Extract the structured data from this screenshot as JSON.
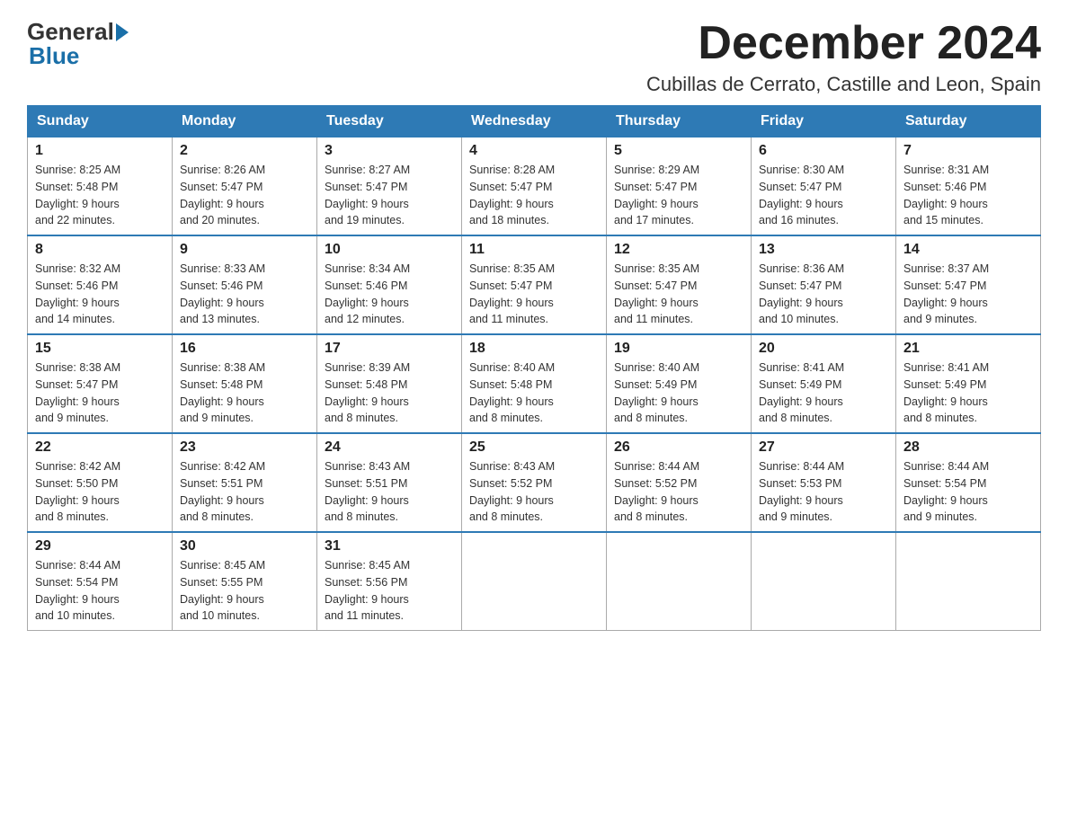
{
  "logo": {
    "general": "General",
    "blue": "Blue"
  },
  "title": {
    "month": "December 2024",
    "location": "Cubillas de Cerrato, Castille and Leon, Spain"
  },
  "weekdays": [
    "Sunday",
    "Monday",
    "Tuesday",
    "Wednesday",
    "Thursday",
    "Friday",
    "Saturday"
  ],
  "weeks": [
    [
      {
        "day": "1",
        "info": "Sunrise: 8:25 AM\nSunset: 5:48 PM\nDaylight: 9 hours\nand 22 minutes."
      },
      {
        "day": "2",
        "info": "Sunrise: 8:26 AM\nSunset: 5:47 PM\nDaylight: 9 hours\nand 20 minutes."
      },
      {
        "day": "3",
        "info": "Sunrise: 8:27 AM\nSunset: 5:47 PM\nDaylight: 9 hours\nand 19 minutes."
      },
      {
        "day": "4",
        "info": "Sunrise: 8:28 AM\nSunset: 5:47 PM\nDaylight: 9 hours\nand 18 minutes."
      },
      {
        "day": "5",
        "info": "Sunrise: 8:29 AM\nSunset: 5:47 PM\nDaylight: 9 hours\nand 17 minutes."
      },
      {
        "day": "6",
        "info": "Sunrise: 8:30 AM\nSunset: 5:47 PM\nDaylight: 9 hours\nand 16 minutes."
      },
      {
        "day": "7",
        "info": "Sunrise: 8:31 AM\nSunset: 5:46 PM\nDaylight: 9 hours\nand 15 minutes."
      }
    ],
    [
      {
        "day": "8",
        "info": "Sunrise: 8:32 AM\nSunset: 5:46 PM\nDaylight: 9 hours\nand 14 minutes."
      },
      {
        "day": "9",
        "info": "Sunrise: 8:33 AM\nSunset: 5:46 PM\nDaylight: 9 hours\nand 13 minutes."
      },
      {
        "day": "10",
        "info": "Sunrise: 8:34 AM\nSunset: 5:46 PM\nDaylight: 9 hours\nand 12 minutes."
      },
      {
        "day": "11",
        "info": "Sunrise: 8:35 AM\nSunset: 5:47 PM\nDaylight: 9 hours\nand 11 minutes."
      },
      {
        "day": "12",
        "info": "Sunrise: 8:35 AM\nSunset: 5:47 PM\nDaylight: 9 hours\nand 11 minutes."
      },
      {
        "day": "13",
        "info": "Sunrise: 8:36 AM\nSunset: 5:47 PM\nDaylight: 9 hours\nand 10 minutes."
      },
      {
        "day": "14",
        "info": "Sunrise: 8:37 AM\nSunset: 5:47 PM\nDaylight: 9 hours\nand 9 minutes."
      }
    ],
    [
      {
        "day": "15",
        "info": "Sunrise: 8:38 AM\nSunset: 5:47 PM\nDaylight: 9 hours\nand 9 minutes."
      },
      {
        "day": "16",
        "info": "Sunrise: 8:38 AM\nSunset: 5:48 PM\nDaylight: 9 hours\nand 9 minutes."
      },
      {
        "day": "17",
        "info": "Sunrise: 8:39 AM\nSunset: 5:48 PM\nDaylight: 9 hours\nand 8 minutes."
      },
      {
        "day": "18",
        "info": "Sunrise: 8:40 AM\nSunset: 5:48 PM\nDaylight: 9 hours\nand 8 minutes."
      },
      {
        "day": "19",
        "info": "Sunrise: 8:40 AM\nSunset: 5:49 PM\nDaylight: 9 hours\nand 8 minutes."
      },
      {
        "day": "20",
        "info": "Sunrise: 8:41 AM\nSunset: 5:49 PM\nDaylight: 9 hours\nand 8 minutes."
      },
      {
        "day": "21",
        "info": "Sunrise: 8:41 AM\nSunset: 5:49 PM\nDaylight: 9 hours\nand 8 minutes."
      }
    ],
    [
      {
        "day": "22",
        "info": "Sunrise: 8:42 AM\nSunset: 5:50 PM\nDaylight: 9 hours\nand 8 minutes."
      },
      {
        "day": "23",
        "info": "Sunrise: 8:42 AM\nSunset: 5:51 PM\nDaylight: 9 hours\nand 8 minutes."
      },
      {
        "day": "24",
        "info": "Sunrise: 8:43 AM\nSunset: 5:51 PM\nDaylight: 9 hours\nand 8 minutes."
      },
      {
        "day": "25",
        "info": "Sunrise: 8:43 AM\nSunset: 5:52 PM\nDaylight: 9 hours\nand 8 minutes."
      },
      {
        "day": "26",
        "info": "Sunrise: 8:44 AM\nSunset: 5:52 PM\nDaylight: 9 hours\nand 8 minutes."
      },
      {
        "day": "27",
        "info": "Sunrise: 8:44 AM\nSunset: 5:53 PM\nDaylight: 9 hours\nand 9 minutes."
      },
      {
        "day": "28",
        "info": "Sunrise: 8:44 AM\nSunset: 5:54 PM\nDaylight: 9 hours\nand 9 minutes."
      }
    ],
    [
      {
        "day": "29",
        "info": "Sunrise: 8:44 AM\nSunset: 5:54 PM\nDaylight: 9 hours\nand 10 minutes."
      },
      {
        "day": "30",
        "info": "Sunrise: 8:45 AM\nSunset: 5:55 PM\nDaylight: 9 hours\nand 10 minutes."
      },
      {
        "day": "31",
        "info": "Sunrise: 8:45 AM\nSunset: 5:56 PM\nDaylight: 9 hours\nand 11 minutes."
      },
      {
        "day": "",
        "info": ""
      },
      {
        "day": "",
        "info": ""
      },
      {
        "day": "",
        "info": ""
      },
      {
        "day": "",
        "info": ""
      }
    ]
  ]
}
